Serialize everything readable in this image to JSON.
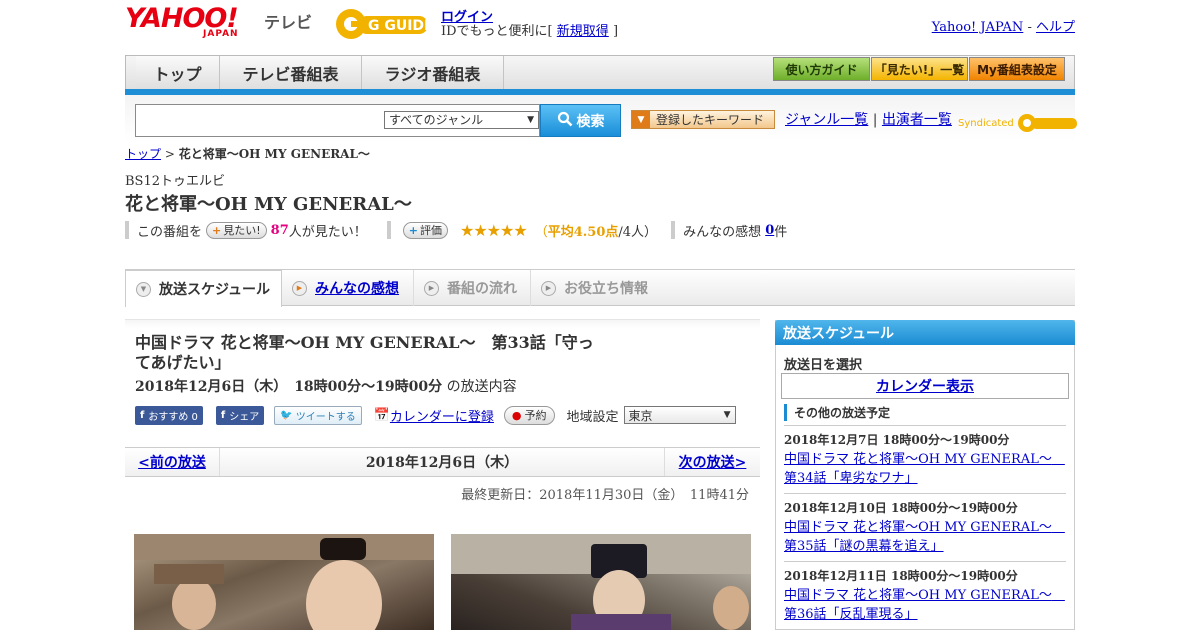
{
  "header": {
    "yahoo_logo": "YAHOO!",
    "yahoo_logo_sub": "JAPAN",
    "tv_label": "テレビ",
    "gguide_logo": "G GUIDE",
    "login_link": "ログイン",
    "login_sub_prefix": "IDでもっと便利に[",
    "register_link": "新規取得",
    "login_sub_suffix": "]",
    "yahoo_japan_link": "Yahoo! JAPAN",
    "separator": " - ",
    "help_link": "ヘルプ"
  },
  "nav": {
    "tabs": [
      "トップ",
      "テレビ番組表",
      "ラジオ番組表"
    ],
    "buttons": [
      "使い方ガイド",
      "「見たい!」一覧",
      "My番組表設定"
    ]
  },
  "search": {
    "genre_value": "すべてのジャンル",
    "search_button": "検索",
    "keyword_button": "登録したキーワード",
    "genre_list_link": "ジャンル一覧",
    "pipe": "|",
    "performer_list_link": "出演者一覧",
    "syndicated": "Syndicated"
  },
  "breadcrumb": {
    "top": "トップ",
    "sep": " > ",
    "current": "花と将軍～OH MY GENERAL～"
  },
  "program": {
    "station": "BS12トゥエルビ",
    "title": "花と将軍～OH MY GENERAL～",
    "mitai_prefix": "この番組を",
    "mitai_button": "見たい!",
    "mitai_count": "87",
    "mitai_suffix": "人が見たい！",
    "rate_button": "評価",
    "stars": "★★★★★",
    "rating_open": "（",
    "rating_label": "平均",
    "rating_value": "4.50点",
    "rating_count": "/4人）",
    "impressions_label": "みんなの感想",
    "impressions_count": "0",
    "impressions_unit": "件"
  },
  "content_tabs": [
    "放送スケジュール",
    "みんなの感想",
    "番組の流れ",
    "お役立ち情報"
  ],
  "episode": {
    "title": "中国ドラマ 花と将軍～OH MY GENERAL～　第33話「守ってあげたい」",
    "datetime": "2018年12月6日（木）　18時00分～19時00分",
    "datetime_suffix": " の放送内容",
    "fb_recommend": "おすすめ 0",
    "fb_share": "シェア",
    "tweet": "ツイートする",
    "calendar_link": "カレンダーに登録",
    "reserve": "予約",
    "region_label": "地域設定",
    "region_value": "東京"
  },
  "pager": {
    "prev": "<前の放送",
    "date": "2018年12月6日（木）",
    "next": "次の放送>"
  },
  "updated": "最終更新日：2018年11月30日（金）　11時41分",
  "sidebar": {
    "header": "放送スケジュール",
    "select_date": "放送日を選択",
    "calendar_button": "カレンダー表示",
    "other_label": "その他の放送予定",
    "items": [
      {
        "when": "2018年12月7日  18時00分～19時00分",
        "what": "中国ドラマ 花と将軍～OH MY GENERAL～　第34話「卑劣なワナ」"
      },
      {
        "when": "2018年12月10日  18時00分～19時00分",
        "what": "中国ドラマ 花と将軍～OH MY GENERAL～　第35話「謎の黒幕を追え」"
      },
      {
        "when": "2018年12月11日  18時00分～19時00分",
        "what": "中国ドラマ 花と将軍～OH MY GENERAL～　第36話「反乱軍現る」"
      }
    ]
  },
  "colors": {
    "accent_blue": "#1b8bd3",
    "yahoo_red": "#e60012",
    "gguide_yellow": "#f2b200",
    "nav_green": "#8cc63f",
    "nav_orange": "#f39800",
    "link": "#0000cc"
  }
}
